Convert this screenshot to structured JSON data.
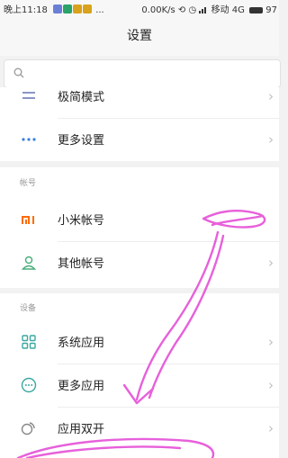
{
  "status_bar": {
    "time": "晚上11:18",
    "dots": "...",
    "speed": "0.00K/s",
    "carrier": "移动 4G",
    "battery": "97"
  },
  "header": {
    "title": "设置"
  },
  "search": {
    "placeholder": ""
  },
  "list_top": [
    {
      "label": "极简模式",
      "icon": "minimal-mode-icon"
    },
    {
      "label": "更多设置",
      "icon": "more-dots-icon"
    }
  ],
  "accounts": {
    "section_label": "帐号",
    "items": [
      {
        "label": "小米帐号",
        "icon": "mi-logo-icon"
      },
      {
        "label": "其他帐号",
        "icon": "person-icon"
      }
    ]
  },
  "device": {
    "section_label": "设备",
    "items": [
      {
        "label": "系统应用",
        "icon": "grid-apps-icon"
      },
      {
        "label": "更多应用",
        "icon": "more-apps-icon"
      },
      {
        "label": "应用双开",
        "icon": "dual-apps-icon"
      }
    ]
  },
  "colors": {
    "mi_orange": "#ff6a00",
    "icon_green": "#4caf7d",
    "icon_teal": "#3aa8a0",
    "annotation_pink": "#e54fd6"
  }
}
